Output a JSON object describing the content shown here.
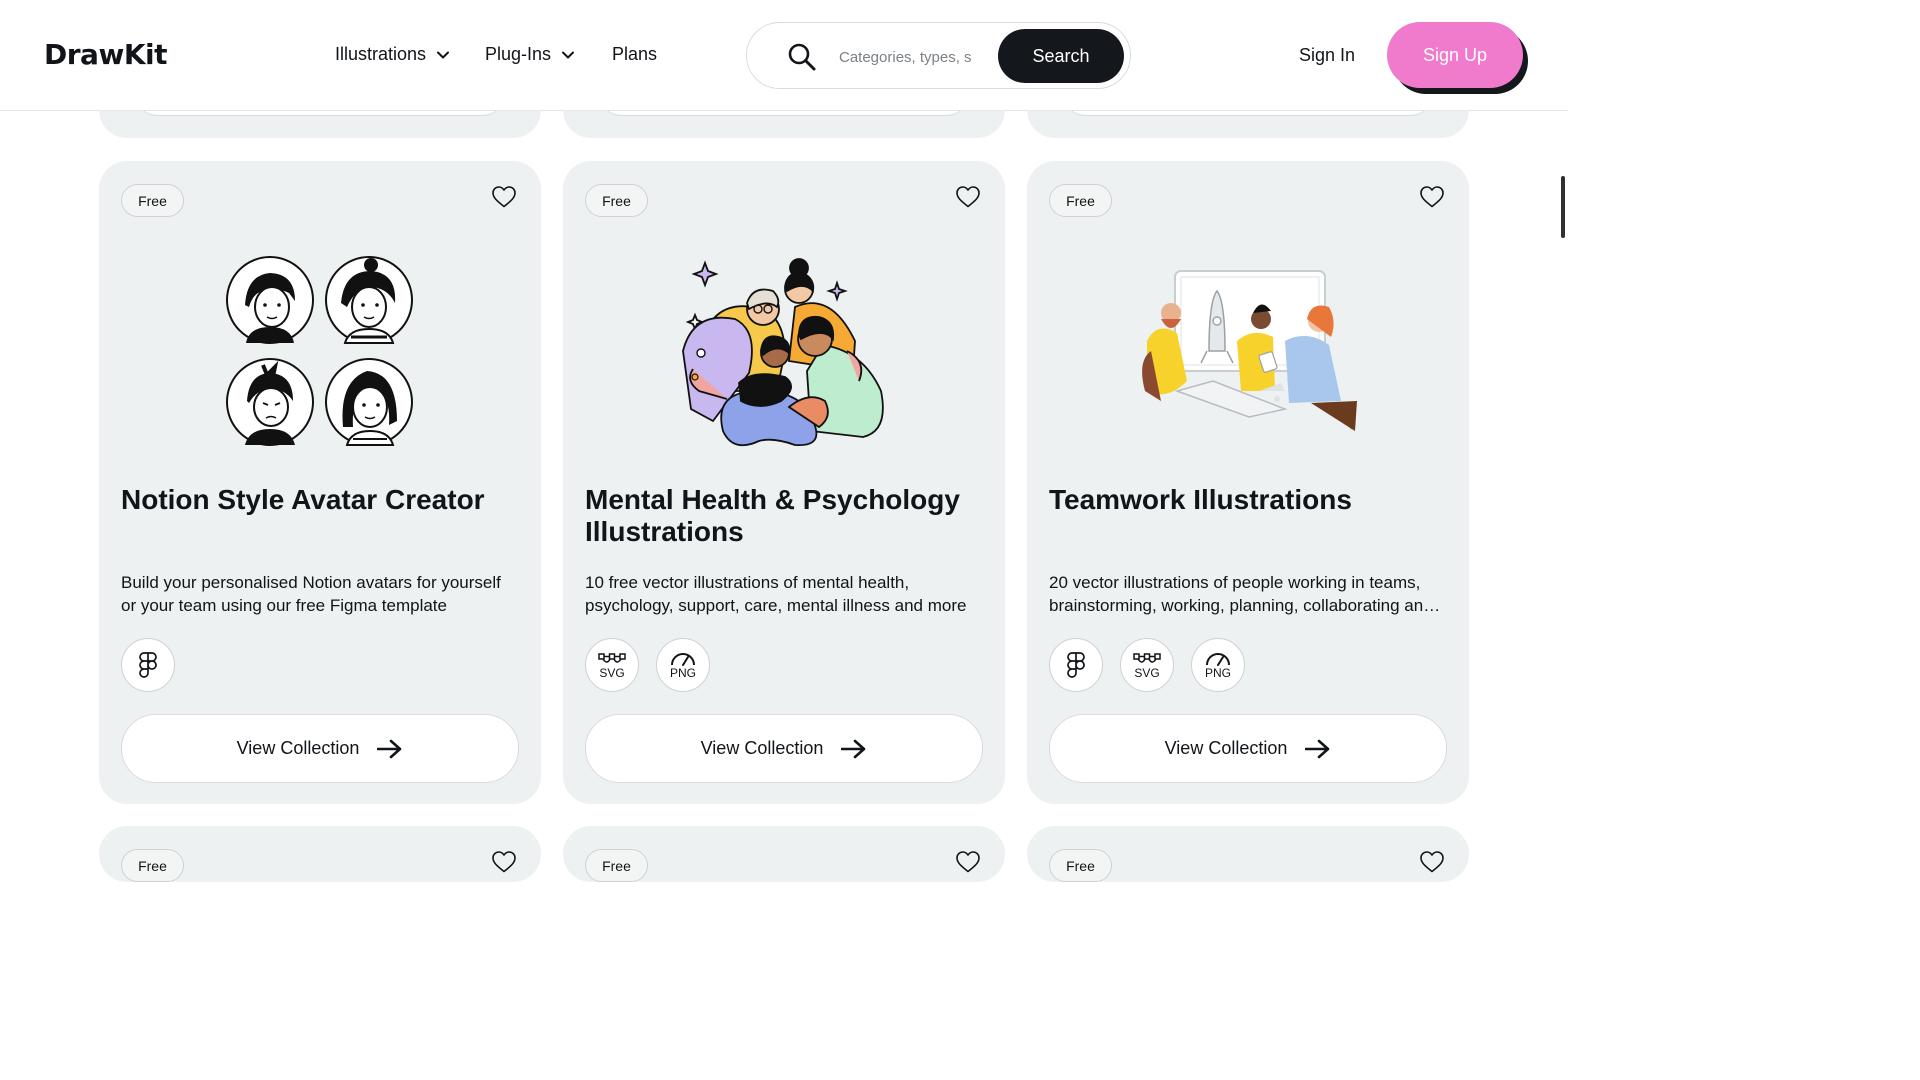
{
  "header": {
    "logo": "DrawKit",
    "nav": [
      {
        "label": "Illustrations",
        "has_dropdown": true
      },
      {
        "label": "Plug-Ins",
        "has_dropdown": true
      },
      {
        "label": "Plans",
        "has_dropdown": false
      }
    ],
    "search": {
      "placeholder": "Categories, types, s",
      "button_label": "Search"
    },
    "sign_in": "Sign In",
    "sign_up": "Sign Up"
  },
  "colors": {
    "accent_pink": "#f07acb",
    "dark": "#14181c",
    "card_bg": "#edf1f1"
  },
  "cards": [
    {
      "badge": "Free",
      "title": "Notion Style Avatar Creator",
      "description": [
        "Build your personalised Notion avatars for yourself",
        "or your team using our free Figma template"
      ],
      "formats": [
        "figma"
      ],
      "button_label": "View Collection"
    },
    {
      "badge": "Free",
      "title": "Mental Health & Psychology Illustrations",
      "description": [
        "10 free vector illustrations of mental health,",
        "psychology, support, care, mental illness and more"
      ],
      "formats": [
        "SVG",
        "PNG"
      ],
      "button_label": "View Collection"
    },
    {
      "badge": "Free",
      "title": "Teamwork Illustrations",
      "description": [
        "20 vector illustrations of people working in teams,",
        "brainstorming, working, planning, collaborating an…"
      ],
      "formats": [
        "figma",
        "SVG",
        "PNG"
      ],
      "button_label": "View Collection"
    }
  ],
  "bottom_cards": [
    {
      "badge": "Free"
    },
    {
      "badge": "Free"
    },
    {
      "badge": "Free"
    }
  ]
}
